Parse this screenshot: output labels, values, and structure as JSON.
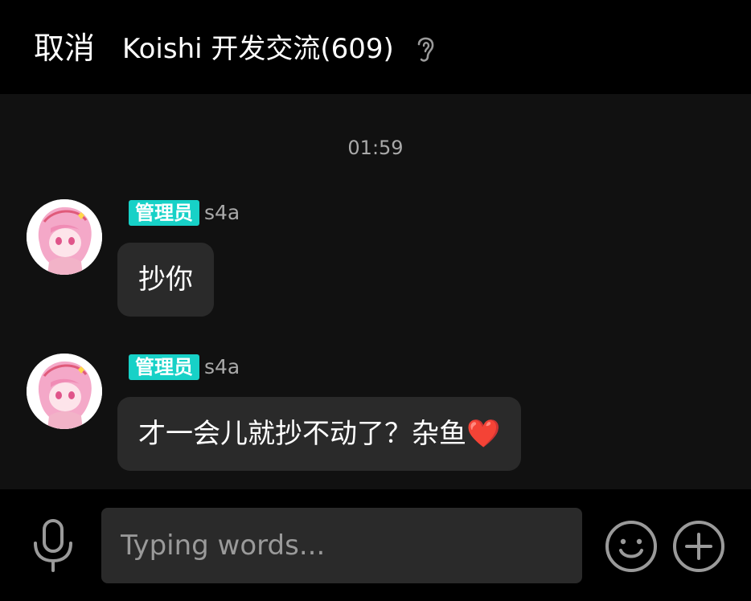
{
  "header": {
    "cancel_label": "取消",
    "title": "Koishi 开发交流(609)",
    "ear_icon": "ear-icon"
  },
  "chat": {
    "timestamp": "01:59",
    "messages": [
      {
        "role_badge": "管理员",
        "sender": "s4a",
        "text": "抄你"
      },
      {
        "role_badge": "管理员",
        "sender": "s4a",
        "text": "才一会儿就抄不动了？杂鱼❤️"
      }
    ]
  },
  "input_bar": {
    "placeholder": "Typing words...",
    "icons": [
      "microphone-icon",
      "emoji-icon",
      "plus-icon"
    ]
  },
  "colors": {
    "background": "#111111",
    "bars": "#000000",
    "bubble": "#2a2a2a",
    "badge": "#17d1c7",
    "muted_text": "#a9a9a9"
  }
}
